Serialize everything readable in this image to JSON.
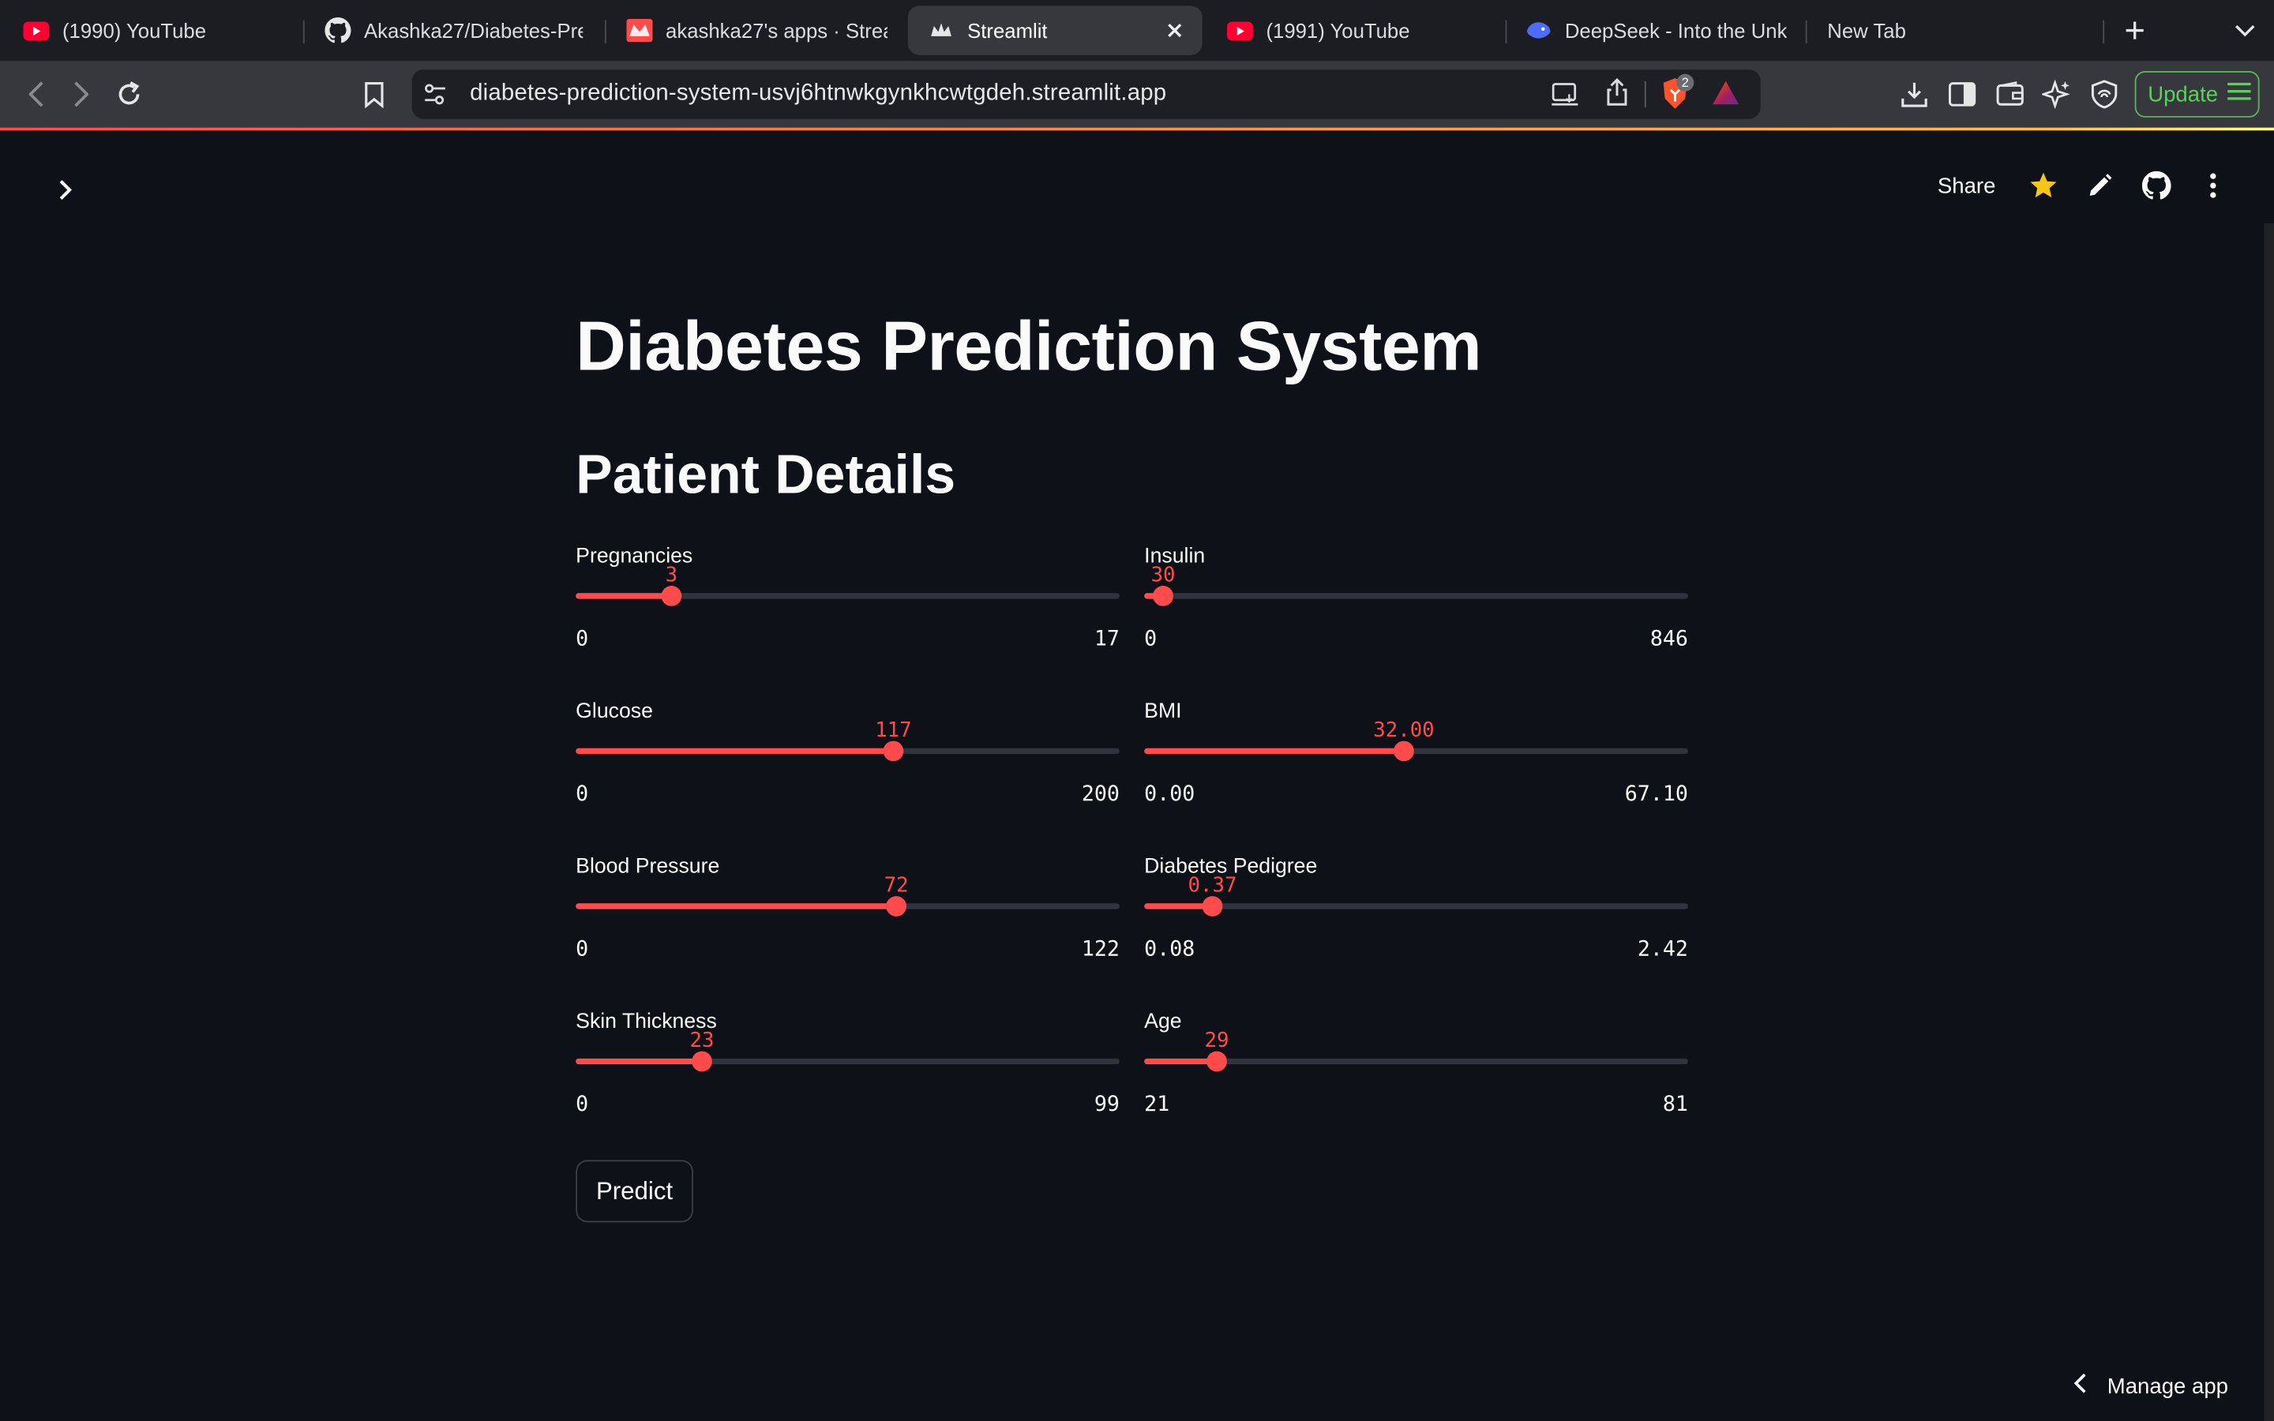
{
  "browser": {
    "tabs": [
      {
        "title": "(1990) YouTube",
        "icon": "youtube-icon"
      },
      {
        "title": "Akashka27/Diabetes-Pre",
        "icon": "github-icon"
      },
      {
        "title": "akashka27's apps · Strea",
        "icon": "streamlit-icon"
      },
      {
        "title": "Streamlit",
        "icon": "streamlit-crown-icon",
        "active": true
      },
      {
        "title": "(1991) YouTube",
        "icon": "youtube-icon"
      },
      {
        "title": "DeepSeek - Into the Unk",
        "icon": "deepseek-icon"
      },
      {
        "title": "New Tab",
        "icon": ""
      }
    ],
    "url": "diabetes-prediction-system-usvj6htnwkgynkhcwtgdeh.streamlit.app",
    "shield_badge": "2",
    "update_label": "Update",
    "colors": {
      "accent": "#ff4b4b",
      "update": "#5bd15b"
    }
  },
  "app": {
    "share_label": "Share",
    "title": "Diabetes Prediction System",
    "subtitle": "Patient Details",
    "sliders": [
      {
        "label": "Pregnancies",
        "value": "3",
        "min": "0",
        "max": "17",
        "fraction": 0.176
      },
      {
        "label": "Insulin",
        "value": "30",
        "min": "0",
        "max": "846",
        "fraction": 0.035
      },
      {
        "label": "Glucose",
        "value": "117",
        "min": "0",
        "max": "200",
        "fraction": 0.585
      },
      {
        "label": "BMI",
        "value": "32.00",
        "min": "0.00",
        "max": "67.10",
        "fraction": 0.477
      },
      {
        "label": "Blood Pressure",
        "value": "72",
        "min": "0",
        "max": "122",
        "fraction": 0.59
      },
      {
        "label": "Diabetes Pedigree",
        "value": "0.37",
        "min": "0.08",
        "max": "2.42",
        "fraction": 0.124
      },
      {
        "label": "Skin Thickness",
        "value": "23",
        "min": "0",
        "max": "99",
        "fraction": 0.232
      },
      {
        "label": "Age",
        "value": "29",
        "min": "21",
        "max": "81",
        "fraction": 0.133
      }
    ],
    "predict_label": "Predict",
    "manage_label": "Manage app"
  }
}
